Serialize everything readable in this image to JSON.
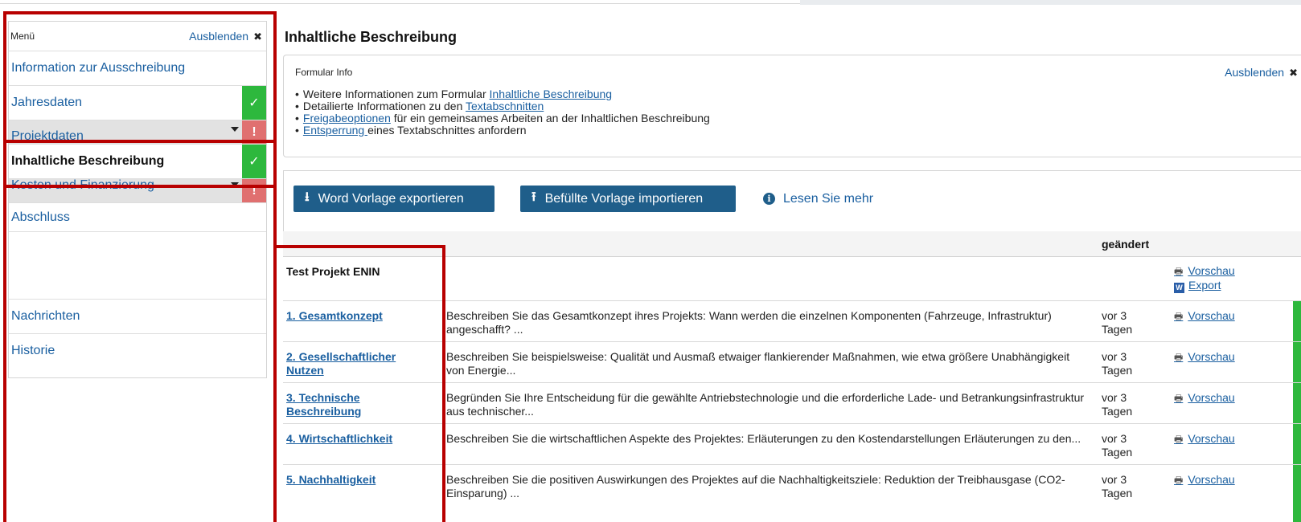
{
  "sidebar": {
    "title": "Menü",
    "hide_label": "Ausblenden",
    "close_glyph": "✖",
    "items": [
      {
        "label": "Information zur Ausschreibung"
      },
      {
        "label": "Jahresdaten",
        "status": "ok",
        "status_glyph": "✓"
      },
      {
        "label": "Projektdaten",
        "status": "error",
        "status_glyph": "!"
      },
      {
        "label": "Inhaltliche Beschreibung",
        "status": "ok",
        "status_glyph": "✓"
      },
      {
        "label": "Kosten und Finanzierung",
        "status": "error",
        "status_glyph": "!"
      },
      {
        "label": "Abschluss"
      },
      {
        "label": "Nachrichten"
      },
      {
        "label": "Historie"
      }
    ]
  },
  "main": {
    "title": "Inhaltliche Beschreibung",
    "info": {
      "title": "Formular Info",
      "hide_label": "Ausblenden",
      "close_glyph": "✖",
      "lines": [
        {
          "pre": "Weitere Informationen zum Formular ",
          "link": "Inhaltliche Beschreibung",
          "post": ""
        },
        {
          "pre": "Detailierte Informationen zu den ",
          "link": "Textabschnitten",
          "post": ""
        },
        {
          "pre": "",
          "link": "Freigabeoptionen",
          "post": " für ein gemeinsames Arbeiten an der Inhaltlichen Beschreibung"
        },
        {
          "pre": "",
          "link": "Entsperrung ",
          "post": "eines Textabschnittes anfordern"
        }
      ]
    },
    "actions": {
      "export_label": "Word Vorlage exportieren",
      "export_icon": "⭳",
      "import_label": "Befüllte Vorlage importieren",
      "import_icon": "⭱",
      "readmore_label": "Lesen Sie mehr",
      "readmore_icon": "i"
    },
    "table": {
      "col_changed": "geändert",
      "project": {
        "name": "Test Projekt ENIN",
        "preview": "Vorschau",
        "export": "Export",
        "preview_icon": "🖶",
        "export_icon": "W"
      },
      "rows": [
        {
          "name": "1. Gesamtkonzept",
          "desc": "Beschreiben Sie das Gesamtkonzept ihres Projekts: Wann werden die einzelnen Komponenten (Fahrzeuge, Infrastruktur) angeschafft? ...",
          "changed": "vor 3 Tagen",
          "action": "Vorschau"
        },
        {
          "name": "2. Gesellschaftlicher Nutzen",
          "desc": "Beschreiben Sie beispielsweise: Qualität und Ausmaß etwaiger flankierender Maßnahmen, wie etwa größere Unabhängigkeit von Energie...",
          "changed": "vor 3 Tagen",
          "action": "Vorschau"
        },
        {
          "name": "3. Technische Beschreibung",
          "desc": "Begründen Sie Ihre Entscheidung für die gewählte Antriebstechnologie und die erforderliche Lade- und Betrankungsinfrastruktur aus technischer...",
          "changed": "vor 3 Tagen",
          "action": "Vorschau"
        },
        {
          "name": "4. Wirtschaftlichkeit",
          "desc": "Beschreiben Sie die wirtschaftlichen Aspekte des Projektes: Erläuterungen zu den Kostendarstellungen Erläuterungen zu den...",
          "changed": "vor 3 Tagen",
          "action": "Vorschau"
        },
        {
          "name": "5. Nachhaltigkeit",
          "desc": "Beschreiben Sie die positiven Auswirkungen des Projektes auf die Nachhaltigkeitsziele: Reduktion der Treibhausgase (CO2-Einsparung) ...",
          "changed": "vor 3 Tagen",
          "action": "Vorschau"
        }
      ]
    }
  },
  "colors": {
    "accent": "#1f5e8a",
    "link": "#1a5fa0",
    "ok": "#2db83d",
    "error": "#e07070",
    "annotation": "#b80000"
  }
}
